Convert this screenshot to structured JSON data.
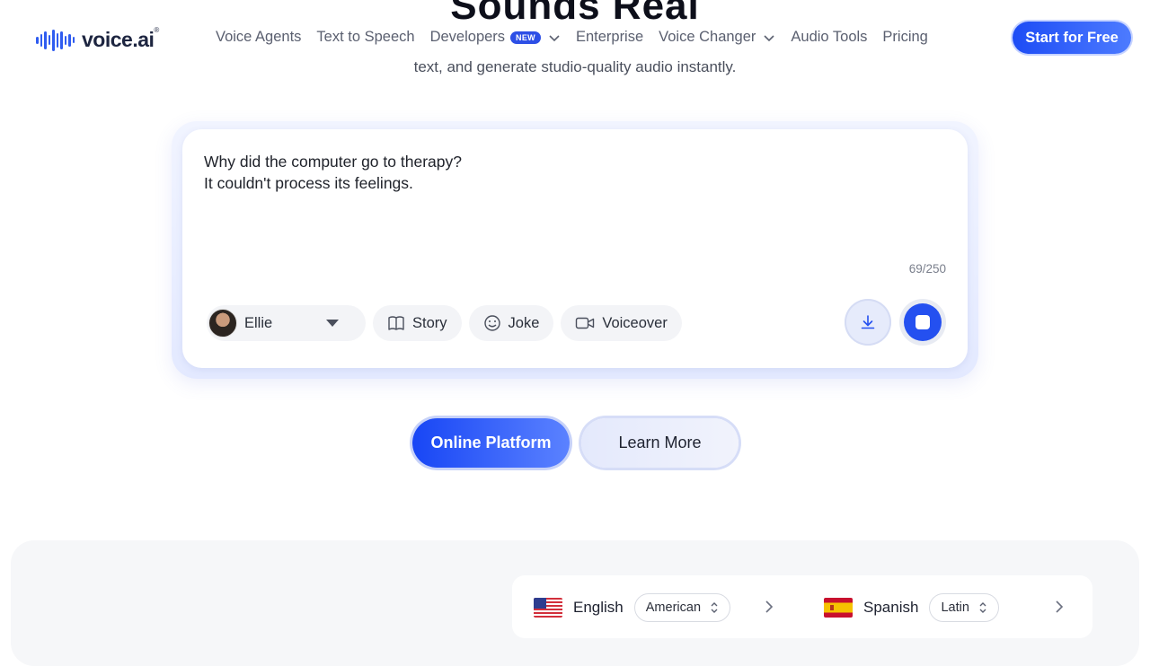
{
  "hero": {
    "title": "Sounds Real",
    "subtitle": "text, and generate studio-quality audio instantly."
  },
  "header": {
    "logo_text": "voice.ai",
    "logo_mark": "®",
    "nav": [
      {
        "label": "Voice Agents"
      },
      {
        "label": "Text to Speech"
      },
      {
        "label": "Developers",
        "badge": "NEW",
        "dropdown": true
      },
      {
        "label": "Enterprise"
      },
      {
        "label": "Voice Changer",
        "dropdown": true
      },
      {
        "label": "Audio Tools"
      },
      {
        "label": "Pricing"
      }
    ],
    "cta": "Start for Free"
  },
  "editor": {
    "line1": "Why did the computer go to therapy?",
    "line2": "It couldn't process its feelings.",
    "char_count": "69/250",
    "voice": "Ellie",
    "presets": [
      "Story",
      "Joke",
      "Voiceover"
    ]
  },
  "buttons": {
    "primary": "Online Platform",
    "secondary": "Learn More"
  },
  "languages": [
    {
      "name": "English",
      "dialect": "American",
      "flag": "us-flag"
    },
    {
      "name": "Spanish",
      "dialect": "Latin",
      "flag": "es-flag"
    }
  ],
  "colors": {
    "accent": "#2450f0",
    "text": "#1f2330",
    "muted": "#5b6070"
  }
}
